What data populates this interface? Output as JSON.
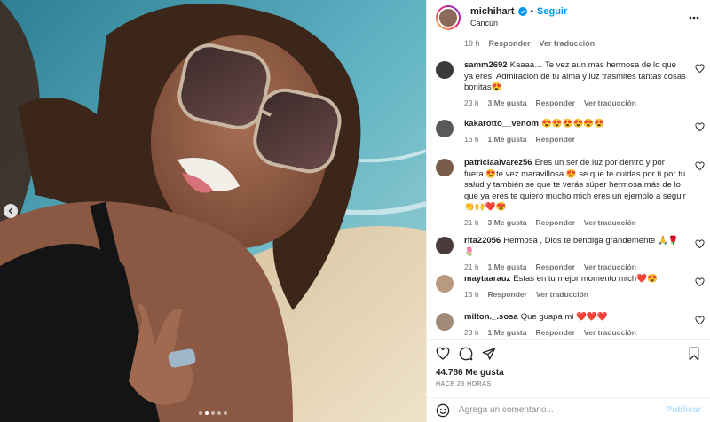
{
  "post": {
    "username": "michihart",
    "follow_label": "Seguir",
    "separator": "•",
    "location": "Cancún",
    "likes": "44.786 Me gusta",
    "posted": "HACE 23 HORAS"
  },
  "first_meta": {
    "time": "19 h",
    "reply": "Responder",
    "translate": "Ver traducción"
  },
  "comments": [
    {
      "user": "samm2692",
      "text": "Kaaaa… Te vez aun mas hermosa de lo que ya eres. Admiracion de tu alma y luz trasmites tantas cosas bonitas😍",
      "time": "23 h",
      "likes": "3 Me gusta",
      "reply": "Responder",
      "translate": "Ver traducción",
      "avatar_color": "#3a3a3a"
    },
    {
      "user": "kakarotto__venom",
      "text": "😍😍😍😍😍😍",
      "time": "16 h",
      "likes": "1 Me gusta",
      "reply": "Responder",
      "translate": "",
      "avatar_color": "#5a5a5a"
    },
    {
      "user": "patriciaalvarez56",
      "text": "Eres un ser de luz por dentro y por fuera 😍te vez maravillosa 😍 se que te cuidas por ti por tu salud y también se que te verás súper hermosa más de lo que ya eres te quiero mucho mich eres un ejemplo a seguir 👏🙌❤️😍",
      "time": "21 h",
      "likes": "3 Me gusta",
      "reply": "Responder",
      "translate": "Ver traducción",
      "avatar_color": "#7a5c4a"
    },
    {
      "user": "rita22056",
      "text": "Hermosa , Dios te bendiga grandemente 🙏🌹🌷",
      "time": "21 h",
      "likes": "1 Me gusta",
      "reply": "Responder",
      "translate": "Ver traducción",
      "avatar_color": "#4a3a3a"
    },
    {
      "user": "maytaarauz",
      "text": "Estas en tu mejor momento mich❤️😍",
      "time": "15 h",
      "likes": "",
      "reply": "Responder",
      "translate": "Ver traducción",
      "avatar_color": "#b89a80"
    },
    {
      "user": "milton._.sosa",
      "text": "Que guapa mi ❤️❤️❤️",
      "time": "23 h",
      "likes": "1 Me gusta",
      "reply": "Responder",
      "translate": "Ver traducción",
      "avatar_color": "#a08a78"
    }
  ],
  "comment_box": {
    "placeholder": "Agrega un comentario...",
    "publish": "Publicar"
  },
  "colors": {
    "accent": "#0095f6",
    "publish_disabled": "#b2dffc",
    "muted": "#737373",
    "heart_red": "#ed4956"
  },
  "icons": [
    "verified-icon",
    "more-icon",
    "heart-icon",
    "comment-icon",
    "share-icon",
    "bookmark-icon",
    "emoji-icon",
    "chevron-left-icon"
  ],
  "carousel": {
    "current": 2,
    "total": 5
  }
}
